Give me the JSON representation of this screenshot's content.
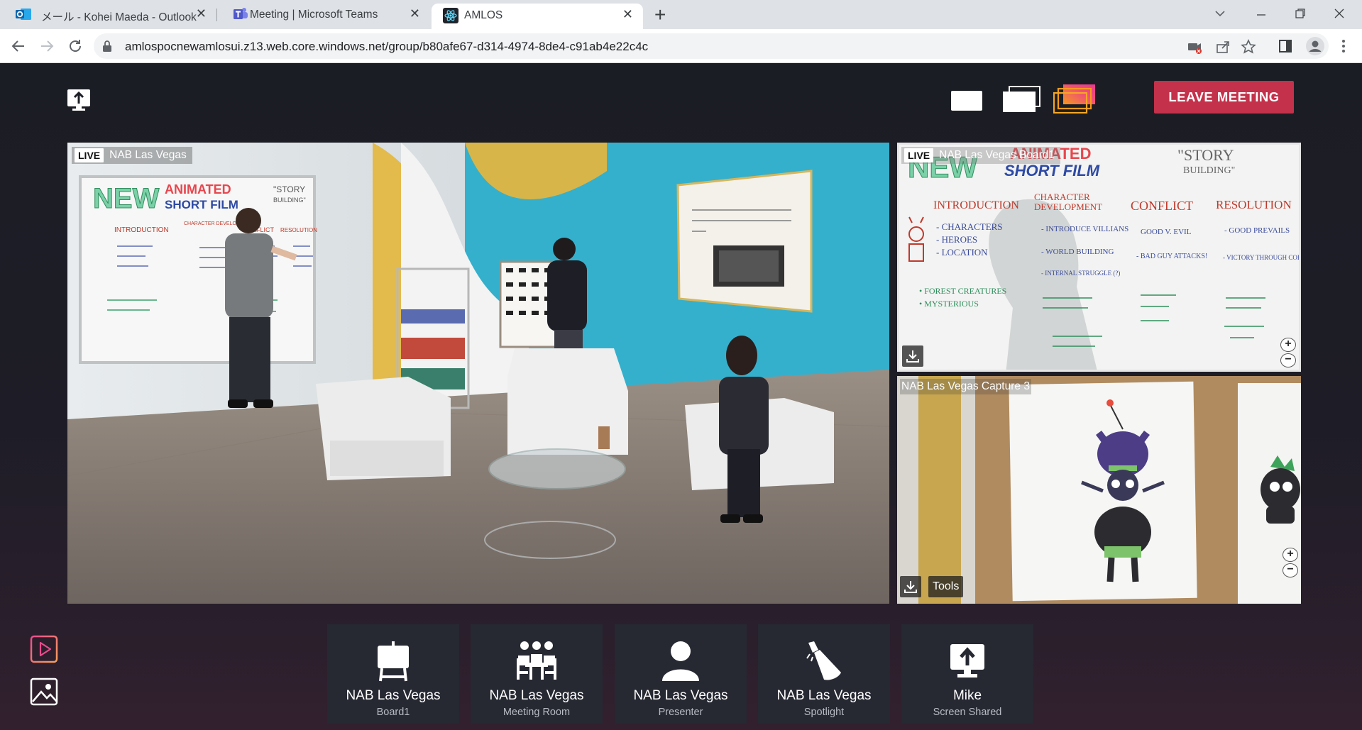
{
  "browser": {
    "tabs": [
      {
        "title": "メール - Kohei Maeda - Outlook",
        "icon": "outlook-icon",
        "active": false
      },
      {
        "title": "Meeting | Microsoft Teams",
        "icon": "teams-icon",
        "active": false
      },
      {
        "title": "AMLOS",
        "icon": "react-icon",
        "active": true
      }
    ],
    "close_glyph": "✕",
    "new_tab_glyph": "+",
    "url": "amlospocnewamlosui.z13.web.core.windows.net/group/b80afe67-d314-4974-8de4-c91ab4e22c4c"
  },
  "app": {
    "leave_label": "LEAVE MEETING",
    "accent_color": "#c4314b",
    "live_badge": "LIVE",
    "feeds": {
      "main": {
        "label": "NAB Las Vegas",
        "live": true
      },
      "board": {
        "label": "NAB Las Vegas Board1",
        "live": true
      },
      "capture": {
        "label": "NAB Las Vegas Capture 3",
        "live": false,
        "tools_label": "Tools"
      }
    },
    "whiteboard": {
      "title_new": "NEW",
      "title_animated": "ANIMATED",
      "title_short_film": "SHORT FILM",
      "story": "\"STORY",
      "building": "BUILDING\"",
      "columns": [
        {
          "head": "INTRODUCTION",
          "lines": [
            "- CHARACTERS",
            "- HEROES",
            "- LOCATION"
          ]
        },
        {
          "head": "CHARACTER DEVELOPMENT",
          "lines": [
            "- INTRODUCE VILLIANS",
            "- WORLD BUILDING",
            "- INTERNAL STRUGGLE (?)"
          ]
        },
        {
          "head": "CONFLICT",
          "lines": [
            "GOOD V. EVIL",
            "- BAD GUY ATTACKS!"
          ]
        },
        {
          "head": "RESOLUTION",
          "lines": [
            "- GOOD PREVAILS",
            "- VICTORY THROUGH COLLABORATION!!"
          ]
        }
      ],
      "notes_left": [
        "• FOREST CREATURES",
        "• MYSTERIOUS"
      ]
    },
    "sources": [
      {
        "name": "NAB Las Vegas",
        "sub": "Board1",
        "icon": "whiteboard-icon"
      },
      {
        "name": "NAB Las Vegas",
        "sub": "Meeting Room",
        "icon": "meeting-room-icon"
      },
      {
        "name": "NAB Las Vegas",
        "sub": "Presenter",
        "icon": "person-icon"
      },
      {
        "name": "NAB Las Vegas",
        "sub": "Spotlight",
        "icon": "spotlight-icon"
      },
      {
        "name": "Mike",
        "sub": "Screen Shared",
        "icon": "screen-share-icon"
      }
    ]
  }
}
